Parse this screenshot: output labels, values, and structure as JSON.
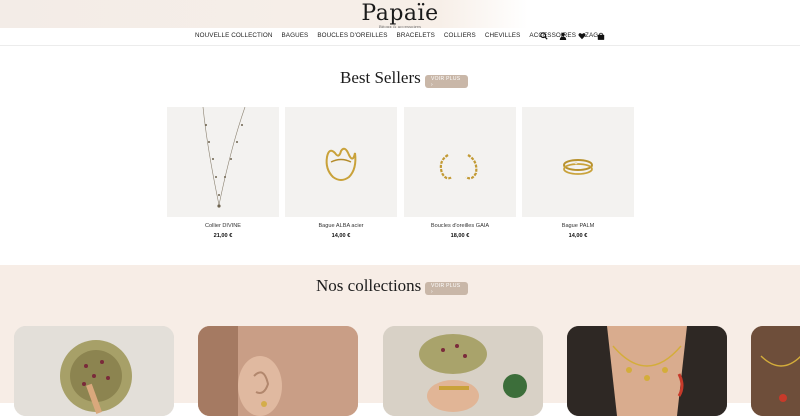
{
  "brand": {
    "name": "Papaïe",
    "tagline": "Bijoux & accessoires"
  },
  "nav": {
    "items": [
      "NOUVELLE COLLECTION",
      "BAGUES",
      "BOUCLES D'OREILLES",
      "BRACELETS",
      "COLLIERS",
      "CHEVILLES",
      "ACCESSOIRES",
      "ZAG"
    ],
    "icons": [
      "search-icon",
      "user-icon",
      "heart-icon",
      "bag-icon"
    ]
  },
  "best_sellers": {
    "title": "Best Sellers",
    "button": "VOIR PLUS  ›",
    "products": [
      {
        "name": "Collier DIVINE",
        "price": "21,00 €"
      },
      {
        "name": "Bague ALBA acier",
        "price": "14,00 €"
      },
      {
        "name": "Boucles d'oreilles GAIA",
        "price": "18,00 €"
      },
      {
        "name": "Bague PALM",
        "price": "14,00 €"
      }
    ]
  },
  "collections": {
    "title": "Nos collections",
    "button": "VOIR PLUS  ›"
  },
  "colors": {
    "accent": "#c9b7a8",
    "band": "#f7ede6"
  }
}
